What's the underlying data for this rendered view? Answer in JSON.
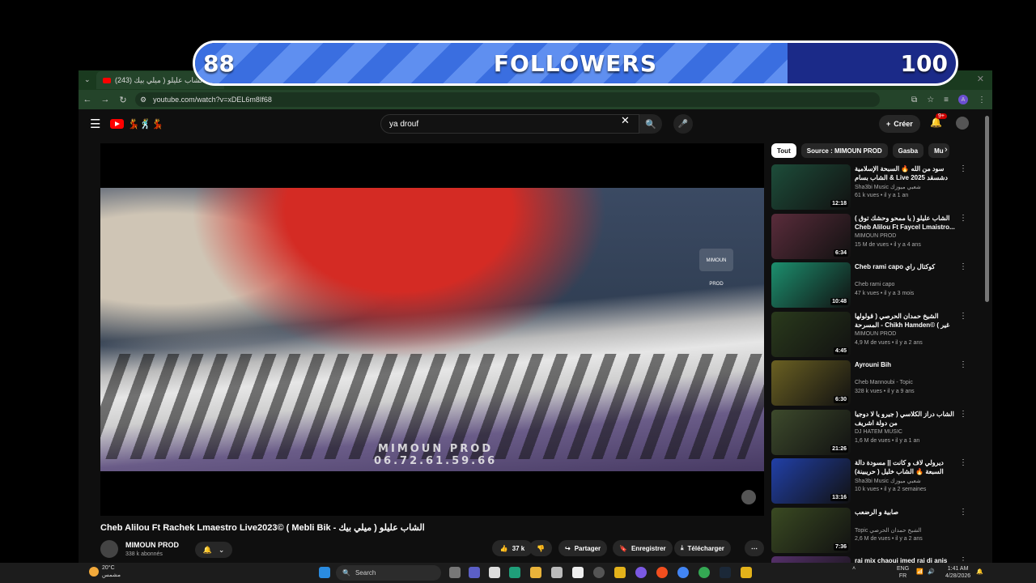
{
  "overlay": {
    "current": "88",
    "title": "FOLLOWERS",
    "goal": "100",
    "progress": 0.88
  },
  "browser": {
    "tab_title": "(243) الشاب عليلو ( ميلي بيك",
    "url": "youtube.com/watch?v=xDEL6m8If68"
  },
  "youtube": {
    "search_value": "ya drouf",
    "create_label": "Créer",
    "notif_count": "9+"
  },
  "video": {
    "watermark_line1": "MIMOUN PROD",
    "watermark_line2": "06.72.61.59.66",
    "watermark_logo": "MIMOUN PROD",
    "title": "الشاب عليلو ( ميلي بيك - Mebli Bik ) ©Cheb Alilou Ft Rachek Lmaestro Live2023",
    "channel": "MIMOUN PROD",
    "subscribers": "338 k abonnés",
    "likes": "37 k",
    "share": "Partager",
    "save": "Enregistrer",
    "download": "Télécharger"
  },
  "chips": [
    "Tout",
    "Source : MIMOUN PROD",
    "Gasba",
    "Mu"
  ],
  "recommendations": [
    {
      "title": "سود من الله 🔥 السبحة الإسلامية الشاب بسام & Live 2025 دشسقد رحالة",
      "channel": "Sha3bi Music شعبي ميوزك",
      "meta": "61 k vues • il y a 1 an",
      "duration": "12:18",
      "color": "#1d4d3a"
    },
    {
      "title": "الشاب عليلو ( يا ممحو وحشك توق ) Cheb Alilou Ft Faycel Lmaistro...",
      "channel": "MIMOUN PROD",
      "meta": "15 M de vues • il y a 4 ans",
      "duration": "6:34",
      "color": "#5a2c3b"
    },
    {
      "title": "Cheb rami capo كوكتال راي",
      "channel": "Cheb rami capo",
      "meta": "47 k vues • il y a 3 mois",
      "duration": "10:48",
      "color": "#1c8f6e"
    },
    {
      "title": "الشيخ حمدان الحرصي ( قولولها المسرحة - Chikh Hamden© ( غير صلى بركة ...",
      "channel": "MIMOUN PROD",
      "meta": "4,9 M de vues • il y a 2 ans",
      "duration": "4:45",
      "color": "#2a3a1c"
    },
    {
      "title": "Ayrouni Bih",
      "channel": "Cheb Mannoubi - Topic",
      "meta": "328 k vues • il y a 9 ans",
      "duration": "6:30",
      "color": "#6a6022"
    },
    {
      "title": "الشاب دراز الكلاسي ( جيرو يا لا دوجيا من دولة اشريف",
      "channel": "DJ HATEM MUSIC",
      "meta": "1,6 M de vues • il y a 1 an",
      "duration": "21:26",
      "color": "#3d4a2c"
    },
    {
      "title": "ديرولي لاف و كانت || مسودة دالة السبعة 🔥 الشاب خليل ( حريبينة) 2026",
      "channel": "Sha3bi Music شعبي ميوزك",
      "meta": "10 k vues • il y a 2 semaines",
      "duration": "13:16",
      "color": "#2140a8"
    },
    {
      "title": "صابية و الرضعب",
      "channel": "Topic الشيخ حمدان الحرصي",
      "meta": "2,6 M de vues • il y a 2 ans",
      "duration": "7:36",
      "color": "#3a4a22"
    },
    {
      "title": "rai mix chaoui imed rai di anis",
      "channel": "",
      "meta": "",
      "duration": "",
      "color": "#55306a"
    }
  ],
  "taskbar": {
    "temp": "20°C",
    "weather": "مشمس",
    "search": "Search",
    "lang_top": "ENG",
    "lang_bottom": "FR",
    "time": "1:41 AM",
    "date": "4/28/2026"
  }
}
